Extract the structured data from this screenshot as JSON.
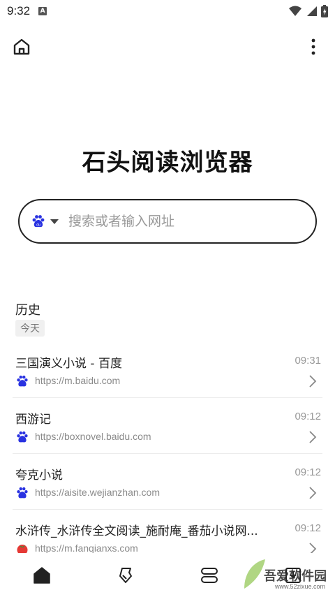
{
  "status_bar": {
    "time": "9:32",
    "notif_glyph": "A"
  },
  "header": {
    "home_icon": "home-outline-icon",
    "more_icon": "more-vertical-icon"
  },
  "app_title": "石头阅读浏览器",
  "search": {
    "placeholder": "搜索或者输入网址",
    "engine_icon": "baidu-paw-icon"
  },
  "history": {
    "heading": "历史",
    "date_label": "今天",
    "items": [
      {
        "title": "三国演义小说 - 百度",
        "url": "https://m.baidu.com",
        "time": "09:31",
        "favicon": "baidu-paw-icon"
      },
      {
        "title": "西游记",
        "url": "https://boxnovel.baidu.com",
        "time": "09:12",
        "favicon": "baidu-paw-icon"
      },
      {
        "title": "夸克小说",
        "url": "https://aisite.wejianzhan.com",
        "time": "09:12",
        "favicon": "baidu-paw-icon"
      },
      {
        "title": "水浒传_水浒传全文阅读_施耐庵_番茄小说网...",
        "url": "https://m.fanqianxs.com",
        "time": "09:12",
        "favicon": "tomato-icon"
      }
    ]
  },
  "bottom_nav": [
    {
      "icon": "home-filled-icon"
    },
    {
      "icon": "bookmark-icon"
    },
    {
      "icon": "tabs-icon"
    },
    {
      "icon": "download-icon"
    }
  ],
  "watermark": {
    "text": "吾爱软件园",
    "url": "www.52zixue.com"
  },
  "colors": {
    "baidu_blue": "#2932e1",
    "text": "#222222",
    "muted": "#999999"
  }
}
